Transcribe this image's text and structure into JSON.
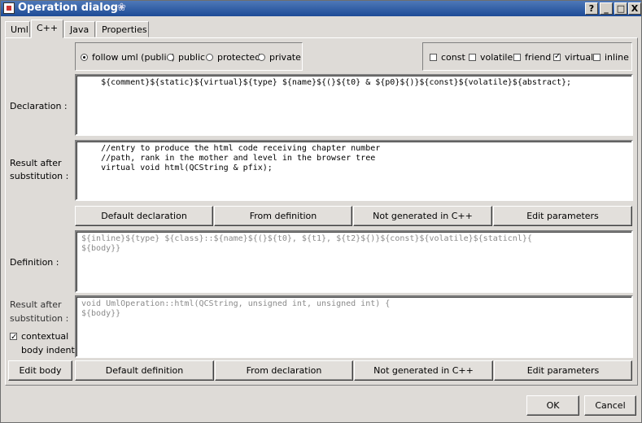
{
  "window": {
    "title": "Operation dialog",
    "controls": [
      "?",
      "_",
      "□",
      "X"
    ]
  },
  "tabs": [
    "Uml",
    "C++",
    "Java",
    "Properties"
  ],
  "visibility": {
    "options": [
      "follow uml (public)",
      "public",
      "protected",
      "private"
    ],
    "selected": "follow uml (public)"
  },
  "modifiers": {
    "options": [
      {
        "label": "const",
        "checked": false
      },
      {
        "label": "volatile",
        "checked": false
      },
      {
        "label": "friend",
        "checked": false
      },
      {
        "label": "virtual",
        "checked": true
      },
      {
        "label": "inline",
        "checked": false
      }
    ]
  },
  "declaration": {
    "label": "Declaration :",
    "value": "    ${comment}${static}${virtual}${type} ${name}${(}${t0} & ${p0}${)}${const}${volatile}${abstract};"
  },
  "decl_result": {
    "label_line1": "Result after",
    "label_line2": "substitution :",
    "value": "    //entry to produce the html code receiving chapter number\n    //path, rank in the mother and level in the browser tree\n    virtual void html(QCString & pfix);"
  },
  "decl_buttons": [
    "Default declaration",
    "From definition",
    "Not generated in C++",
    "Edit parameters"
  ],
  "definition": {
    "label": "Definition :",
    "value": "${inline}${type} ${class}::${name}${(}${t0}, ${t1}, ${t2}${)}${const}${volatile}${staticnl}{\n${body}}"
  },
  "def_result": {
    "label_line1": "Result after",
    "label_line2": "substitution :",
    "value": "void UmlOperation::html(QCString, unsigned int, unsigned int) {\n${body}}",
    "contextual_line1": "contextual",
    "contextual_line2": "body indent",
    "contextual_checked": true
  },
  "def_buttons": [
    "Edit body",
    "Default definition",
    "From declaration",
    "Not generated in C++",
    "Edit parameters"
  ],
  "footer": {
    "ok": "OK",
    "cancel": "Cancel"
  }
}
